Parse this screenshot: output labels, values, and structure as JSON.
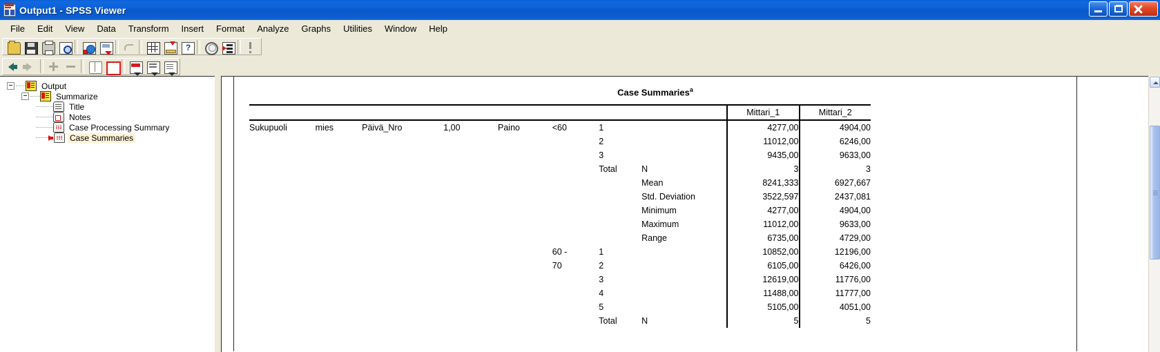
{
  "window": {
    "title": "Output1 - SPSS Viewer",
    "app_icon": "spss-viewer-icon",
    "buttons": {
      "minimize": "minimize-button",
      "restore": "restore-button",
      "close": "close-button"
    }
  },
  "menubar": {
    "items": [
      {
        "label": "File"
      },
      {
        "label": "Edit"
      },
      {
        "label": "View"
      },
      {
        "label": "Data"
      },
      {
        "label": "Transform"
      },
      {
        "label": "Insert"
      },
      {
        "label": "Format"
      },
      {
        "label": "Analyze"
      },
      {
        "label": "Graphs"
      },
      {
        "label": "Utilities"
      },
      {
        "label": "Window"
      },
      {
        "label": "Help"
      }
    ]
  },
  "toolbar_main": {
    "buttons": [
      {
        "name": "open-file-icon"
      },
      {
        "name": "save-file-icon"
      },
      {
        "name": "print-icon"
      },
      {
        "name": "print-preview-icon"
      },
      {
        "name": "export-web-icon"
      },
      {
        "name": "export-icon"
      },
      {
        "name": "undo-icon"
      },
      {
        "name": "go-to-data-icon"
      },
      {
        "name": "insert-cases-icon"
      },
      {
        "name": "variables-help-icon"
      },
      {
        "name": "select-cases-icon"
      },
      {
        "name": "pivot-table-icon"
      },
      {
        "name": "run-icon"
      }
    ]
  },
  "toolbar_outline": {
    "buttons": [
      {
        "name": "promote-left-icon"
      },
      {
        "name": "demote-right-icon"
      },
      {
        "name": "expand-plus-icon"
      },
      {
        "name": "collapse-minus-icon"
      },
      {
        "name": "show-all-icon"
      },
      {
        "name": "hide-all-icon"
      },
      {
        "name": "insert-heading-icon"
      },
      {
        "name": "insert-title-icon"
      },
      {
        "name": "insert-text-icon"
      }
    ]
  },
  "outline": {
    "nodes": [
      {
        "label": "Output",
        "icon": "output-icon",
        "depth": 0,
        "toggle": "minus",
        "selected": false,
        "marker": false
      },
      {
        "label": "Summarize",
        "icon": "output-icon",
        "depth": 1,
        "toggle": "minus",
        "selected": false,
        "marker": false
      },
      {
        "label": "Title",
        "icon": "title-icon",
        "depth": 2,
        "toggle": "none",
        "selected": false,
        "marker": false
      },
      {
        "label": "Notes",
        "icon": "notes-icon",
        "depth": 2,
        "toggle": "none",
        "selected": false,
        "marker": false
      },
      {
        "label": "Case Processing Summary",
        "icon": "table-icon",
        "depth": 2,
        "toggle": "none",
        "selected": false,
        "marker": false
      },
      {
        "label": "Case Summaries",
        "icon": "table-icon",
        "depth": 2,
        "toggle": "none",
        "selected": true,
        "marker": true
      }
    ]
  },
  "output": {
    "table_title": "Case Summaries",
    "table_title_superscript": "a",
    "column_headers": [
      "",
      "Mittari_1",
      "Mittari_2"
    ],
    "rows": [
      {
        "c1": "Sukupuoli",
        "c2": "mies",
        "c3": "Päivä_Nro",
        "c4": "1,00",
        "c5": "Paino",
        "c6": "<60",
        "c7": "1",
        "c8": "",
        "m1": "4277,00",
        "m2": "4904,00"
      },
      {
        "c1": "",
        "c2": "",
        "c3": "",
        "c4": "",
        "c5": "",
        "c6": "",
        "c7": "2",
        "c8": "",
        "m1": "11012,00",
        "m2": "6246,00"
      },
      {
        "c1": "",
        "c2": "",
        "c3": "",
        "c4": "",
        "c5": "",
        "c6": "",
        "c7": "3",
        "c8": "",
        "m1": "9435,00",
        "m2": "9633,00"
      },
      {
        "c1": "",
        "c2": "",
        "c3": "",
        "c4": "",
        "c5": "",
        "c6": "",
        "c7": "Total",
        "c8": "N",
        "m1": "3",
        "m2": "3"
      },
      {
        "c1": "",
        "c2": "",
        "c3": "",
        "c4": "",
        "c5": "",
        "c6": "",
        "c7": "",
        "c8": "Mean",
        "m1": "8241,333",
        "m2": "6927,667"
      },
      {
        "c1": "",
        "c2": "",
        "c3": "",
        "c4": "",
        "c5": "",
        "c6": "",
        "c7": "",
        "c8": "Std. Deviation",
        "m1": "3522,597",
        "m2": "2437,081"
      },
      {
        "c1": "",
        "c2": "",
        "c3": "",
        "c4": "",
        "c5": "",
        "c6": "",
        "c7": "",
        "c8": "Minimum",
        "m1": "4277,00",
        "m2": "4904,00"
      },
      {
        "c1": "",
        "c2": "",
        "c3": "",
        "c4": "",
        "c5": "",
        "c6": "",
        "c7": "",
        "c8": "Maximum",
        "m1": "11012,00",
        "m2": "9633,00"
      },
      {
        "c1": "",
        "c2": "",
        "c3": "",
        "c4": "",
        "c5": "",
        "c6": "",
        "c7": "",
        "c8": "Range",
        "m1": "6735,00",
        "m2": "4729,00"
      },
      {
        "c1": "",
        "c2": "",
        "c3": "",
        "c4": "",
        "c5": "",
        "c6": "60 -",
        "c7": "1",
        "c8": "",
        "m1": "10852,00",
        "m2": "12196,00"
      },
      {
        "c1": "",
        "c2": "",
        "c3": "",
        "c4": "",
        "c5": "",
        "c6": "70",
        "c7": "2",
        "c8": "",
        "m1": "6105,00",
        "m2": "6426,00"
      },
      {
        "c1": "",
        "c2": "",
        "c3": "",
        "c4": "",
        "c5": "",
        "c6": "",
        "c7": "3",
        "c8": "",
        "m1": "12619,00",
        "m2": "11776,00"
      },
      {
        "c1": "",
        "c2": "",
        "c3": "",
        "c4": "",
        "c5": "",
        "c6": "",
        "c7": "4",
        "c8": "",
        "m1": "11488,00",
        "m2": "11777,00"
      },
      {
        "c1": "",
        "c2": "",
        "c3": "",
        "c4": "",
        "c5": "",
        "c6": "",
        "c7": "5",
        "c8": "",
        "m1": "5105,00",
        "m2": "4051,00"
      },
      {
        "c1": "",
        "c2": "",
        "c3": "",
        "c4": "",
        "c5": "",
        "c6": "",
        "c7": "Total",
        "c8": "N",
        "m1": "5",
        "m2": "5"
      }
    ]
  },
  "scrollbar": {
    "up_arrow": "scroll-up-icon",
    "thumb": "scroll-thumb"
  },
  "colors": {
    "titlebar_blue": "#0a5fd4",
    "chrome": "#ece9d8",
    "selection": "#fdf2d6",
    "marker_red": "#e01010"
  }
}
